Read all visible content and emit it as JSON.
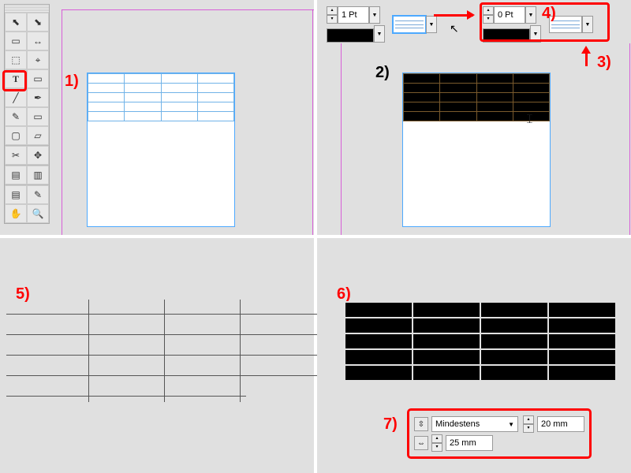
{
  "steps": {
    "s1": "1)",
    "s2": "2)",
    "s3": "3)",
    "s4": "4)",
    "s5": "5)",
    "s6": "6)",
    "s7": "7)"
  },
  "stroke": {
    "weight1": "1 Pt",
    "weight2": "0 Pt"
  },
  "row_height": {
    "mode": "Mindestens",
    "height": "20 mm",
    "width": "25 mm"
  },
  "tools": {
    "selection": "⬉",
    "direct": "⬊",
    "page": "▭",
    "gap": "↔",
    "content": "⬚",
    "placer": "⌖",
    "text": "T",
    "frame": "▭",
    "line": "╱",
    "pen": "✒",
    "pencil": "✎",
    "rect": "▭",
    "box": "▢",
    "shape": "▱",
    "scissors": "✂",
    "transform": "✥",
    "gradient": "▤",
    "color": "▥",
    "note": "▤",
    "eyedrop": "✎",
    "hand": "✋",
    "zoom": "🔍"
  }
}
